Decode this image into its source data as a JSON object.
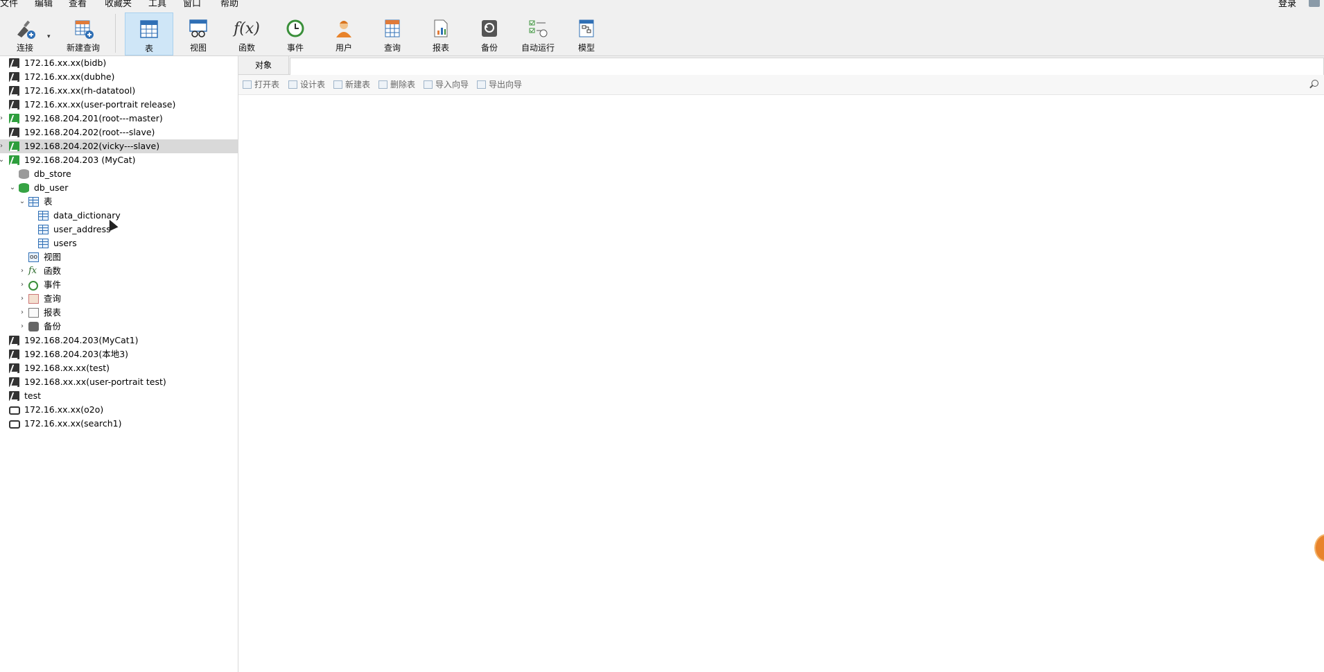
{
  "menubar": {
    "items": [
      "文件",
      "编辑",
      "查看",
      "收藏夹",
      "工具",
      "窗口",
      "帮助"
    ],
    "login": "登录"
  },
  "toolbar": {
    "buttons": [
      {
        "label": "连接",
        "icon": "connect-icon"
      },
      {
        "label": "新建查询",
        "icon": "new-query-icon"
      },
      {
        "label": "表",
        "icon": "table-icon",
        "active": true
      },
      {
        "label": "视图",
        "icon": "view-icon"
      },
      {
        "label": "函数",
        "icon": "function-icon"
      },
      {
        "label": "事件",
        "icon": "event-icon"
      },
      {
        "label": "用户",
        "icon": "user-icon"
      },
      {
        "label": "查询",
        "icon": "query-icon"
      },
      {
        "label": "报表",
        "icon": "report-icon"
      },
      {
        "label": "备份",
        "icon": "backup-icon"
      },
      {
        "label": "自动运行",
        "icon": "schedule-icon"
      },
      {
        "label": "模型",
        "icon": "model-icon"
      }
    ]
  },
  "tree": [
    {
      "label": "172.16.xx.xx(bidb)",
      "type": "conn"
    },
    {
      "label": "172.16.xx.xx(dubhe)",
      "type": "conn"
    },
    {
      "label": "172.16.xx.xx(rh-datatool)",
      "type": "conn"
    },
    {
      "label": "172.16.xx.xx(user-portrait release)",
      "type": "conn"
    },
    {
      "label": "192.168.204.201(root---master)",
      "type": "conn-open",
      "arrow": "›"
    },
    {
      "label": "192.168.204.202(root---slave)",
      "type": "conn"
    },
    {
      "label": "192.168.204.202(vicky---slave)",
      "type": "conn-open",
      "arrow": "›",
      "selected": true
    },
    {
      "label": "192.168.204.203  (MyCat)",
      "type": "conn-open",
      "arrow": "⌄"
    },
    {
      "label": "db_store",
      "type": "db"
    },
    {
      "label": "db_user",
      "type": "db-open",
      "arrow": "⌄"
    },
    {
      "label": "表",
      "type": "tables",
      "arrow": "⌄"
    },
    {
      "label": "data_dictionary",
      "type": "table"
    },
    {
      "label": "user_address",
      "type": "table"
    },
    {
      "label": "users",
      "type": "table"
    },
    {
      "label": "视图",
      "type": "views"
    },
    {
      "label": "函数",
      "type": "functions",
      "arrow": "›"
    },
    {
      "label": "事件",
      "type": "events",
      "arrow": "›"
    },
    {
      "label": "查询",
      "type": "queries",
      "arrow": "›"
    },
    {
      "label": "报表",
      "type": "reports",
      "arrow": "›"
    },
    {
      "label": "备份",
      "type": "backups",
      "arrow": "›"
    },
    {
      "label": "192.168.204.203(MyCat1)",
      "type": "conn"
    },
    {
      "label": "192.168.204.203(本地3)",
      "type": "conn"
    },
    {
      "label": "192.168.xx.xx(test)",
      "type": "conn"
    },
    {
      "label": "192.168.xx.xx(user-portrait test)",
      "type": "conn"
    },
    {
      "label": "test",
      "type": "conn"
    },
    {
      "label": "172.16.xx.xx(o2o)",
      "type": "conn-other"
    },
    {
      "label": "172.16.xx.xx(search1)",
      "type": "conn-other"
    }
  ],
  "main": {
    "tab_label": "对象",
    "object_toolbar": [
      "打开表",
      "设计表",
      "新建表",
      "删除表",
      "导入向导",
      "导出向导"
    ]
  }
}
